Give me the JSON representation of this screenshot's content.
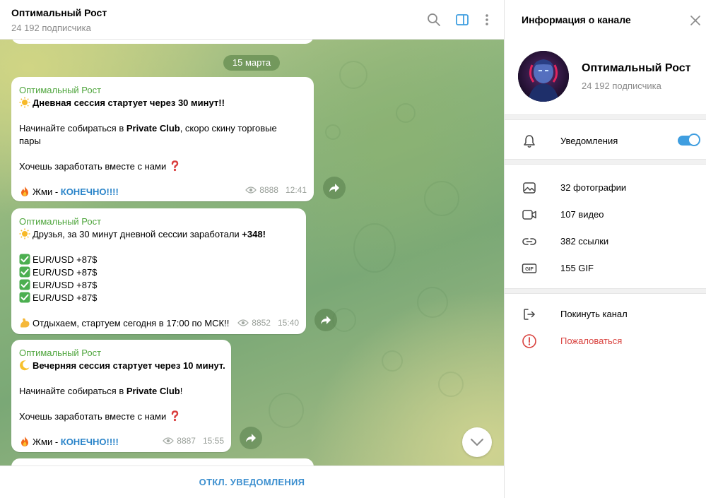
{
  "header": {
    "title": "Оптимальный Рост",
    "subtitle": "24 192 подписчика"
  },
  "chat": {
    "date_label": "15 марта",
    "messages": [
      {
        "author": "Оптимальный Рост",
        "line1_pre": "",
        "line1_bold": "Дневная сессия стартует через 30 минут!!",
        "line2_pre": "Начинайте собираться в ",
        "line2_bold": "Private Club",
        "line2_post": ", скоро скину торговые",
        "line2b": "пары",
        "line3": "Хочешь заработать вместе с нами ",
        "line4_pre": "Жми - ",
        "line4_link": "КОНЕЧНО!!!!",
        "views": "8888",
        "time": "12:41"
      },
      {
        "author": "Оптимальный Рост",
        "line1_pre": "Друзья, за 30 минут дневной сессии заработали ",
        "line1_bold": "+348!",
        "pairs": [
          "EUR/USD +87$",
          "EUR/USD +87$",
          "EUR/USD +87$",
          "EUR/USD +87$"
        ],
        "line_end": "Отдыхаем, стартуем сегодня в 17:00 по МСК!!",
        "views": "8852",
        "time": "15:40"
      },
      {
        "author": "Оптимальный Рост",
        "line1_bold": "Вечерняя сессия стартует через 10 минут.",
        "line2_pre": "Начинайте собираться в ",
        "line2_bold": "Private Club",
        "line2_post": "!",
        "line3": "Хочешь заработать вместе с нами ",
        "line4_pre": "Жми - ",
        "line4_link": "КОНЕЧНО!!!!",
        "views": "8887",
        "time": "15:55"
      }
    ]
  },
  "footer": {
    "mute_label": "ОТКЛ. УВЕДОМЛЕНИЯ"
  },
  "info_panel": {
    "title": "Информация о канале",
    "channel_name": "Оптимальный Рост",
    "subscribers": "24 192 подписчика",
    "notifications_label": "Уведомления",
    "notifications_on": true,
    "media": [
      {
        "icon": "photo-icon",
        "label": "32 фотографии"
      },
      {
        "icon": "video-icon",
        "label": "107 видео"
      },
      {
        "icon": "link-icon",
        "label": "382 ссылки"
      },
      {
        "icon": "gif-icon",
        "label": "155 GIF"
      }
    ],
    "leave_label": "Покинуть канал",
    "report_label": "Пожаловаться"
  },
  "colors": {
    "author_green": "#4ea53c",
    "link_blue": "#2a84c9",
    "accent_blue": "#3f9ee0",
    "danger_red": "#d9433f"
  }
}
